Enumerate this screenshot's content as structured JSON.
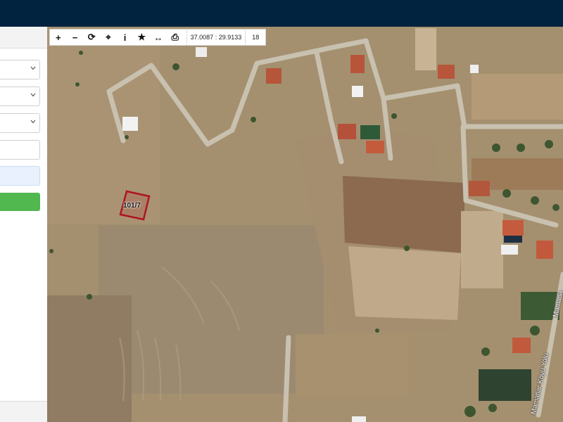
{
  "toolbar": {
    "tools": [
      {
        "icon": "zoom-in-icon",
        "glyph": "+"
      },
      {
        "icon": "zoom-out-icon",
        "glyph": "−"
      },
      {
        "icon": "refresh-icon",
        "glyph": "⟳"
      },
      {
        "icon": "locate-icon",
        "glyph": "⌖"
      },
      {
        "icon": "info-icon",
        "glyph": "i"
      },
      {
        "icon": "star-icon",
        "glyph": "★"
      },
      {
        "icon": "measure-icon",
        "glyph": "↔"
      },
      {
        "icon": "print-icon",
        "glyph": "⎙"
      }
    ],
    "coordinates": "37.0087 : 29.9133",
    "zoom_level": "18"
  },
  "map": {
    "parcel_label": "101/7",
    "road_labels": [
      "Mamatlar Köyü Yolu",
      "Mamatla"
    ],
    "colors": {
      "header": "#02233f",
      "parcel_outline": "#b0141f",
      "sidebar_button": "#51b74f",
      "sidebar_info": "#e8f1fd"
    }
  }
}
